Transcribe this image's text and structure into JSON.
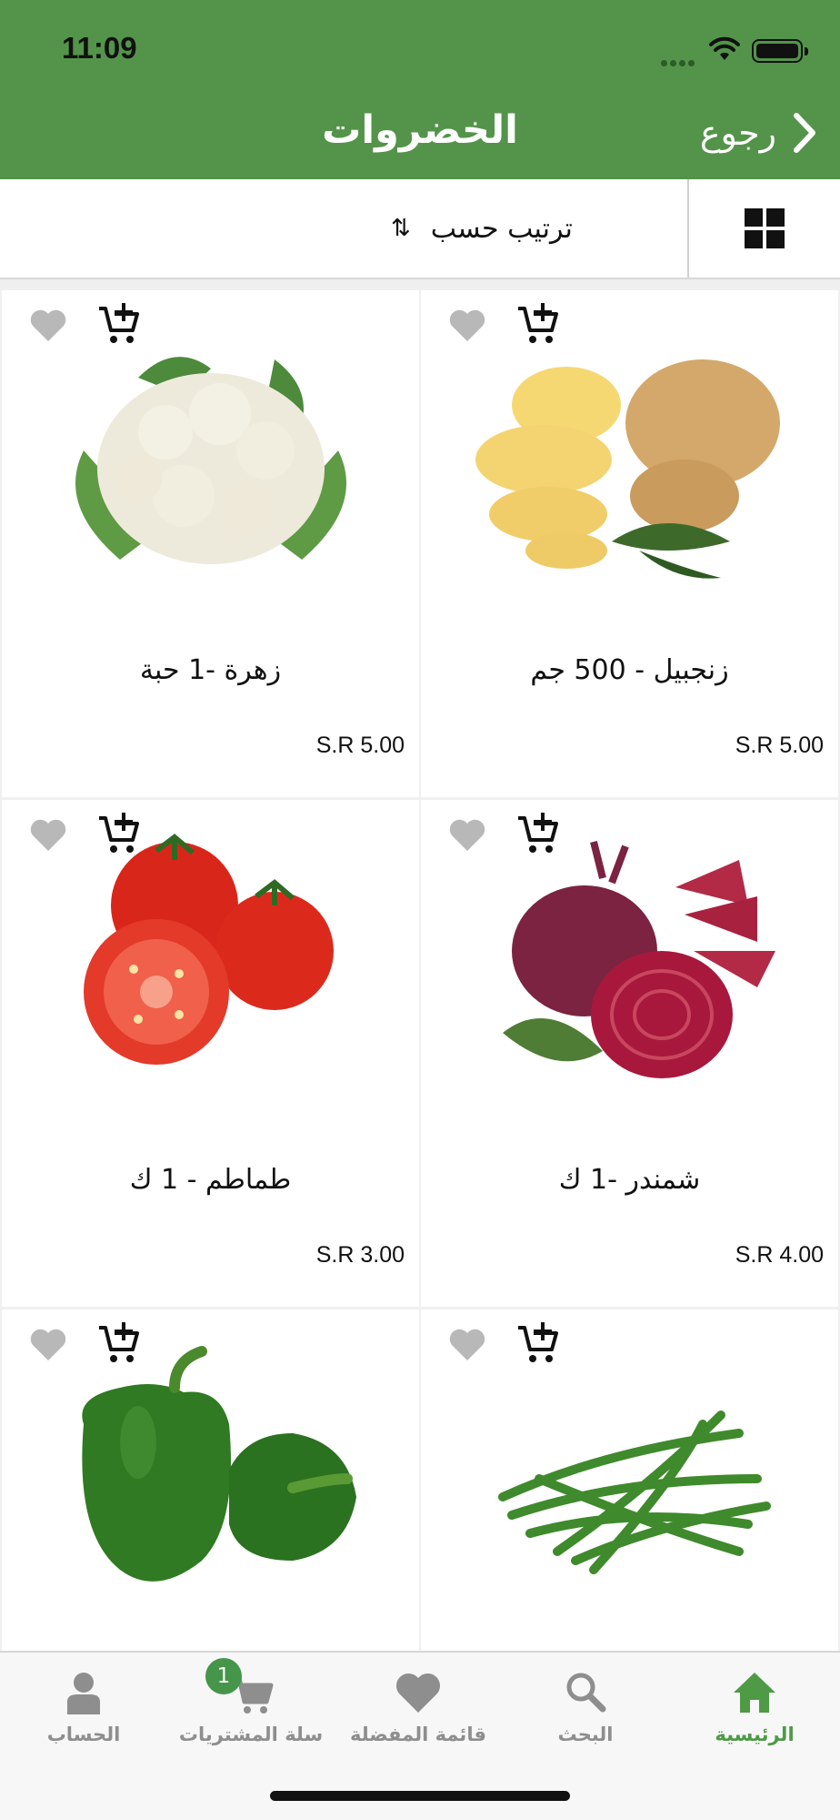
{
  "status_bar": {
    "time": "11:09"
  },
  "header": {
    "title": "الخضروات",
    "back_label": "رجوع"
  },
  "sort_bar": {
    "sort_label": "ترتيب حسب"
  },
  "products": [
    {
      "name": "زنجبيل - 500 جم",
      "price": "S.R 5.00",
      "image": "ginger"
    },
    {
      "name": "زهرة -1 حبة",
      "price": "S.R 5.00",
      "image": "cauliflower"
    },
    {
      "name": "شمندر -1 ك",
      "price": "S.R 4.00",
      "image": "beetroot"
    },
    {
      "name": "طماطم - 1 ك",
      "price": "S.R 3.00",
      "image": "tomato"
    },
    {
      "name": "",
      "price": "",
      "image": "green-beans"
    },
    {
      "name": "",
      "price": "",
      "image": "green-pepper"
    }
  ],
  "tabbar": {
    "home": "الرئيسية",
    "search": "البحث",
    "favorites": "قائمة المفضلة",
    "cart": "سلة المشتريات",
    "cart_count": "1",
    "account": "الحساب"
  },
  "colors": {
    "header": "#53944a",
    "active_tab": "#4f9a45",
    "badge": "#45954a",
    "inactive": "#8e8e8e"
  }
}
